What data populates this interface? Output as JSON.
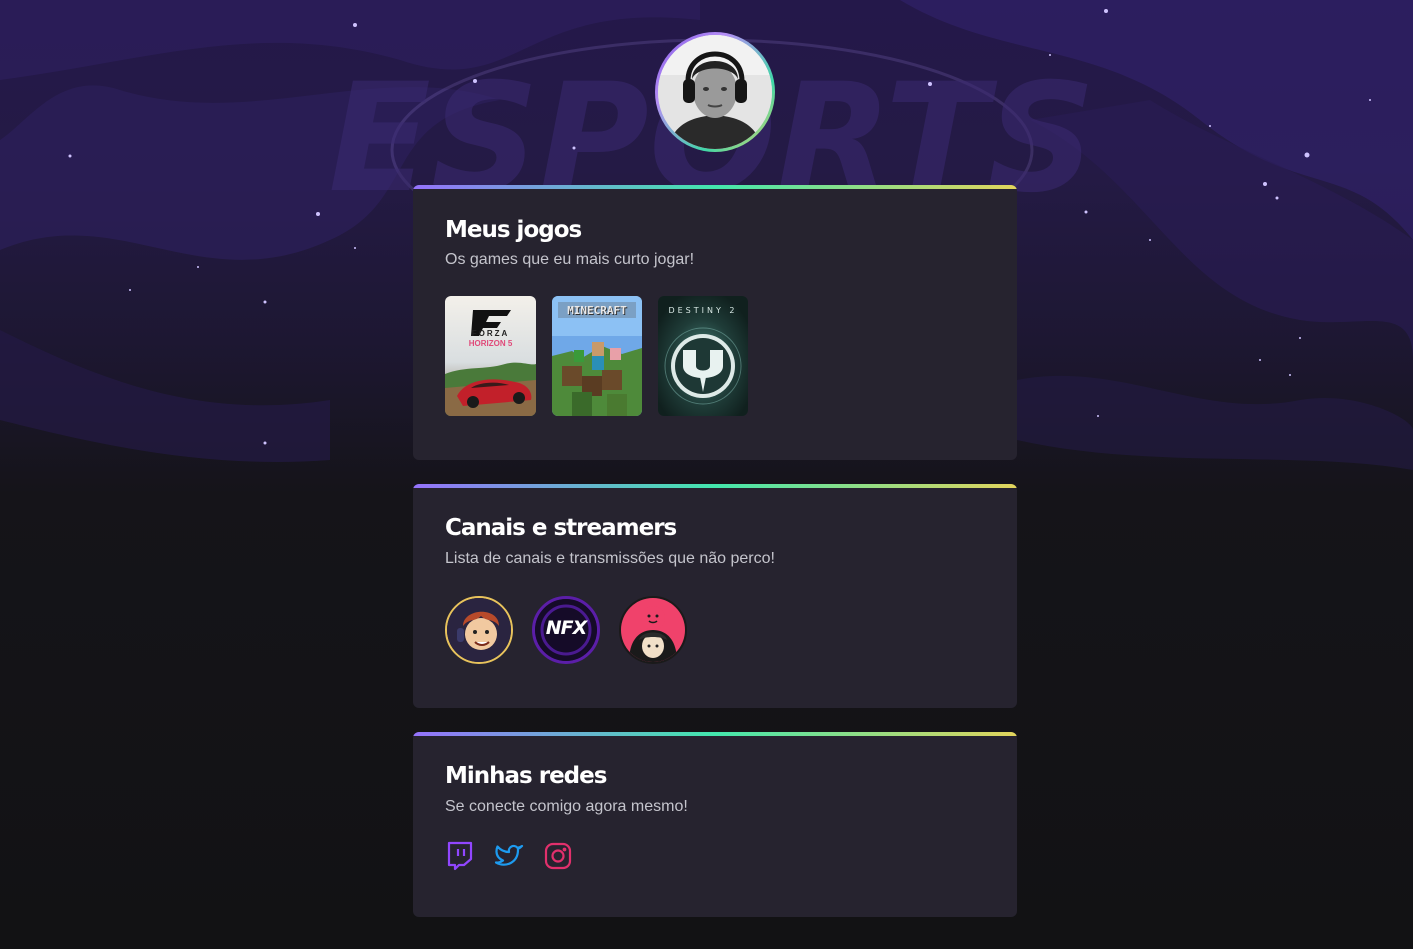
{
  "profile": {
    "avatar_alt": "Foto de perfil"
  },
  "background": {
    "watermark_text": "ESPORTS"
  },
  "sections": {
    "games": {
      "title": "Meus jogos",
      "subtitle": "Os games que eu mais curto jogar!",
      "items": [
        {
          "name": "Forza Horizon 5",
          "logo_line1": "FORZA",
          "logo_line2": "HORIZON 5"
        },
        {
          "name": "Minecraft",
          "logo": "MINECRAFT"
        },
        {
          "name": "Destiny 2",
          "logo": "DESTINY 2"
        }
      ]
    },
    "channels": {
      "title": "Canais e streamers",
      "subtitle": "Lista de canais e transmissões que não perco!",
      "items": [
        {
          "name": "streamer-1",
          "ring_color": "#e8c35c"
        },
        {
          "name": "NFX",
          "label": "NFX",
          "ring_color": "#5b1ea8"
        },
        {
          "name": "streamer-3",
          "ring_color": "#1a1a1a"
        }
      ]
    },
    "social": {
      "title": "Minhas redes",
      "subtitle": "Se conecte comigo agora mesmo!",
      "items": [
        {
          "name": "twitch-icon",
          "color": "#9146ff"
        },
        {
          "name": "twitter-icon",
          "color": "#1d9bf0"
        },
        {
          "name": "instagram-icon",
          "color": "#e1306c"
        }
      ]
    }
  },
  "colors": {
    "card_bg": "#26232f",
    "page_bg": "#121214",
    "gradient_start": "#9572fc",
    "gradient_mid": "#43e7ad",
    "gradient_end": "#e2d45c"
  }
}
